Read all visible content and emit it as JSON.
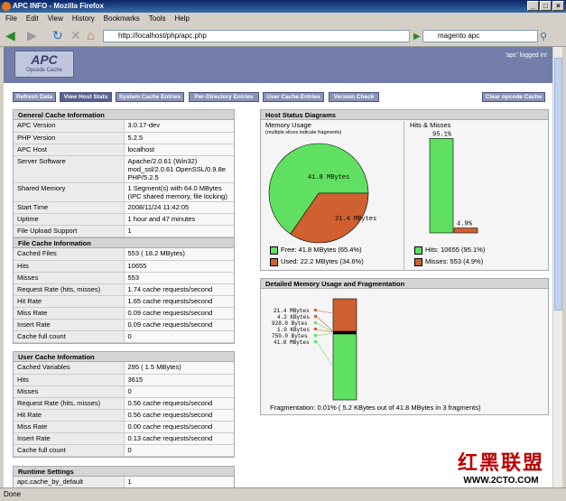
{
  "window": {
    "title": "APC INFO - Mozilla Firefox"
  },
  "menu": [
    "File",
    "Edit",
    "View",
    "History",
    "Bookmarks",
    "Tools",
    "Help"
  ],
  "nav": {
    "url": "http://localhost/php/apc.php",
    "search": "magento apc"
  },
  "apc": {
    "logo": "APC",
    "logo_sub": "Opcode Cache",
    "logged": "'apc' logged in!"
  },
  "buttons": [
    "Refresh Data",
    "View Host Stats",
    "System Cache Entries",
    "Per-Directory Entries",
    "User Cache Entries",
    "Version Check"
  ],
  "clear_button": "Clear opcode Cache",
  "general": {
    "title": "General Cache Information",
    "rows": [
      [
        "APC Version",
        "3.0.17-dev"
      ],
      [
        "PHP Version",
        "5.2.5"
      ],
      [
        "APC Host",
        "localhost"
      ],
      [
        "Server Software",
        "Apache/2.0.61 (Win32) mod_ssl/2.0.61 OpenSSL/0.9.8e PHP/5.2.5"
      ],
      [
        "Shared Memory",
        "1 Segment(s) with 64.0 MBytes (IPC shared memory, file locking)"
      ],
      [
        "Start Time",
        "2008/11/24 11:42:05"
      ],
      [
        "Uptime",
        "1 hour and 47 minutes"
      ],
      [
        "File Upload Support",
        "1"
      ]
    ]
  },
  "file": {
    "title": "File Cache Information",
    "rows": [
      [
        "Cached Files",
        "553 ( 18.2 MBytes)"
      ],
      [
        "Hits",
        "10655"
      ],
      [
        "Misses",
        "553"
      ],
      [
        "Request Rate (hits, misses)",
        "1.74 cache requests/second"
      ],
      [
        "Hit Rate",
        "1.65 cache requests/second"
      ],
      [
        "Miss Rate",
        "0.09 cache requests/second"
      ],
      [
        "Insert Rate",
        "0.09 cache requests/second"
      ],
      [
        "Cache full count",
        "0"
      ]
    ]
  },
  "user": {
    "title": "User Cache Information",
    "rows": [
      [
        "Cached Variables",
        "295 ( 1.5 MBytes)"
      ],
      [
        "Hits",
        "3615"
      ],
      [
        "Misses",
        "0"
      ],
      [
        "Request Rate (hits, misses)",
        "0.56 cache requests/second"
      ],
      [
        "Hit Rate",
        "0.56 cache requests/second"
      ],
      [
        "Miss Rate",
        "0.00 cache requests/second"
      ],
      [
        "Insert Rate",
        "0.13 cache requests/second"
      ],
      [
        "Cache full count",
        "0"
      ]
    ]
  },
  "runtime": {
    "title": "Runtime Settings",
    "rows": [
      [
        "apc.cache_by_default",
        "1"
      ]
    ]
  },
  "host": {
    "title": "Host Status Diagrams",
    "memory_title": "Memory Usage",
    "memory_note": "(multiple slices indicate fragments)",
    "hits_title": "Hits & Misses",
    "pie_free_label": "41.8 MBytes",
    "pie_used_label": "21.4 MBytes",
    "hit_pct": "95.1%",
    "miss_pct": "4.9%",
    "legend_free": "Free: 41.8 MBytes (65.4%)",
    "legend_used": "Used: 22.2 MBytes (34.6%)",
    "legend_hits": "Hits: 10655 (95.1%)",
    "legend_misses": "Misses: 553 (4.9%)"
  },
  "detail": {
    "title": "Detailed Memory Usage and Fragmentation",
    "labels": [
      "21.4 MBytes",
      "4.2 KBytes",
      "928.0 Bytes",
      "1.0 KBytes",
      "750.0 Bytes",
      "41.8 MBytes"
    ],
    "fragmentation": "Fragmentation: 0.01% ( 5.2 KBytes out of 41.8 MBytes in 3 fragments)"
  },
  "chart_data": [
    {
      "type": "pie",
      "title": "Memory Usage",
      "slices": [
        {
          "name": "Free",
          "value": 65.4
        },
        {
          "name": "Used",
          "value": 34.6
        }
      ],
      "labels": [
        "41.8 MBytes",
        "21.4 MBytes"
      ]
    },
    {
      "type": "bar",
      "title": "Hits & Misses",
      "categories": [
        "Hits",
        "Misses"
      ],
      "values": [
        95.1,
        4.9
      ]
    }
  ],
  "colors": {
    "free": "#60e060",
    "used": "#d06030",
    "header": "#737da9"
  },
  "status": "Done",
  "watermark": {
    "cn": "红黑联盟",
    "url": "WWW.2CTO.COM"
  }
}
